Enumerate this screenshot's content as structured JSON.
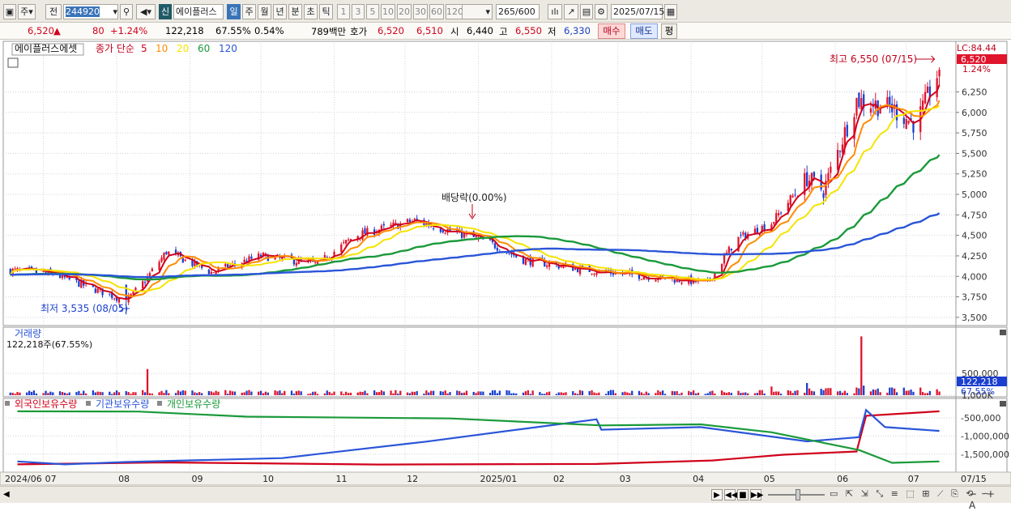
{
  "toolbar": {
    "type_label": "주",
    "prev_label": "전",
    "code": "244920",
    "name": "에이플러스",
    "sin": "신",
    "periods": [
      "일",
      "주",
      "월",
      "년",
      "분",
      "초",
      "틱"
    ],
    "active_period": "일",
    "nums": [
      "1",
      "3",
      "5",
      "10",
      "20",
      "30",
      "60",
      "120"
    ],
    "count": "265",
    "count_total": "/600",
    "date": "2025/07/15"
  },
  "info": {
    "price": "6,520",
    "change": "80",
    "change_pct": "+1.24%",
    "volume": "122,218",
    "vol_ratio": "67.55%",
    "turnover": "0.54%",
    "amount": "789백만",
    "hoga_label": "호가",
    "ask": "6,520",
    "bid": "6,510",
    "open_label": "시",
    "open": "6,440",
    "high_label": "고",
    "high": "6,550",
    "low_label": "저",
    "low": "6,330",
    "buy": "매수",
    "sell": "매도",
    "eval": "평"
  },
  "chart_data": [
    {
      "type": "candlestick",
      "title": "에이플러스에셋",
      "legend": {
        "label": "종가 단순",
        "periods": [
          "5",
          "10",
          "20",
          "60",
          "120"
        ],
        "colors": [
          "#d0021b",
          "#ff8c00",
          "#f5e400",
          "#1a9a3a",
          "#2a55d8"
        ]
      },
      "lc_label": "LC:84.44",
      "last_price_label": "6,520",
      "last_pct_label": "1.24%",
      "y_ticks": [
        "6,250",
        "6,000",
        "5,750",
        "5,500",
        "5,250",
        "5,000",
        "4,750",
        "4,500",
        "4,250",
        "4,000",
        "3,750",
        "3,500"
      ],
      "ylim": [
        3400,
        6650
      ],
      "annotations": {
        "high": "최고 6,550 (07/15)",
        "low": "최저 3,535 (08/05)",
        "dividend": "배당락(0.00%)"
      },
      "x_labels": [
        "2024/06",
        "07",
        "08",
        "09",
        "10",
        "11",
        "12",
        "2025/01",
        "02",
        "03",
        "04",
        "05",
        "06",
        "07"
      ],
      "x_label_right": "07/15",
      "close_keypoints": [
        {
          "date": "2024-06-20",
          "value": 4070
        },
        {
          "date": "2024-07-05",
          "value": 4030
        },
        {
          "date": "2024-08-05",
          "value": 3700
        },
        {
          "date": "2024-08-13",
          "value": 3950
        },
        {
          "date": "2024-08-22",
          "value": 4300
        },
        {
          "date": "2024-09-10",
          "value": 4050
        },
        {
          "date": "2024-10-01",
          "value": 4250
        },
        {
          "date": "2024-10-25",
          "value": 4150
        },
        {
          "date": "2024-11-10",
          "value": 4500
        },
        {
          "date": "2024-12-05",
          "value": 4680
        },
        {
          "date": "2025-01-05",
          "value": 4420
        },
        {
          "date": "2025-01-20",
          "value": 4200
        },
        {
          "date": "2025-02-15",
          "value": 4080
        },
        {
          "date": "2025-03-20",
          "value": 3980
        },
        {
          "date": "2025-04-08",
          "value": 3920
        },
        {
          "date": "2025-04-20",
          "value": 4450
        },
        {
          "date": "2025-05-05",
          "value": 4650
        },
        {
          "date": "2025-05-20",
          "value": 5200
        },
        {
          "date": "2025-05-27",
          "value": 5050
        },
        {
          "date": "2025-06-10",
          "value": 6150
        },
        {
          "date": "2025-06-25",
          "value": 6050
        },
        {
          "date": "2025-07-05",
          "value": 5850
        },
        {
          "date": "2025-07-15",
          "value": 6520
        }
      ]
    },
    {
      "type": "bar",
      "title": "거래량",
      "subtitle": "122,218주(67.55%)",
      "y_ticks": [
        "1,000K",
        "500,000"
      ],
      "last_label": "122,218",
      "last_pct": "67.55%",
      "spikes": [
        {
          "date": "2024-08-14",
          "value": 600000
        },
        {
          "date": "2025-05-05",
          "value": 200000
        },
        {
          "date": "2025-05-20",
          "value": 280000
        },
        {
          "date": "2025-06-12",
          "value": 1350000
        },
        {
          "date": "2025-06-13",
          "value": 220000
        }
      ],
      "typical_value": 70000
    },
    {
      "type": "line",
      "legend": [
        "외국인보유수량",
        "기관보유수량",
        "개인보유수량"
      ],
      "colors": [
        "#d0021b",
        "#2a55d8",
        "#1a9a3a"
      ],
      "y_ticks": [
        "-500,000",
        "-1,000,000",
        "-1,500,000"
      ],
      "series": [
        {
          "name": "외국인보유수량",
          "points": [
            [
              "2024-06-20",
              -1780000
            ],
            [
              "2024-08-20",
              -1730000
            ],
            [
              "2024-11-20",
              -1790000
            ],
            [
              "2025-02-20",
              -1760000
            ],
            [
              "2025-04-10",
              -1680000
            ],
            [
              "2025-05-10",
              -1510000
            ],
            [
              "2025-06-10",
              -1420000
            ],
            [
              "2025-06-14",
              -450000
            ],
            [
              "2025-07-15",
              -320000
            ]
          ]
        },
        {
          "name": "기관보유수량",
          "points": [
            [
              "2024-06-20",
              -1700000
            ],
            [
              "2024-07-10",
              -1780000
            ],
            [
              "2024-08-05",
              -1710000
            ],
            [
              "2024-10-10",
              -1600000
            ],
            [
              "2024-12-10",
              -1150000
            ],
            [
              "2025-01-20",
              -800000
            ],
            [
              "2025-02-20",
              -540000
            ],
            [
              "2025-02-22",
              -830000
            ],
            [
              "2025-04-05",
              -760000
            ],
            [
              "2025-05-20",
              -1150000
            ],
            [
              "2025-06-11",
              -1030000
            ],
            [
              "2025-06-14",
              -280000
            ],
            [
              "2025-06-22",
              -750000
            ],
            [
              "2025-07-15",
              -860000
            ]
          ]
        },
        {
          "name": "개인보유수량",
          "points": [
            [
              "2024-06-20",
              -320000
            ],
            [
              "2024-08-10",
              -330000
            ],
            [
              "2024-09-25",
              -460000
            ],
            [
              "2024-12-20",
              -510000
            ],
            [
              "2025-02-22",
              -700000
            ],
            [
              "2025-04-05",
              -680000
            ],
            [
              "2025-05-05",
              -900000
            ],
            [
              "2025-06-11",
              -1380000
            ],
            [
              "2025-06-25",
              -1740000
            ],
            [
              "2025-07-15",
              -1700000
            ]
          ]
        }
      ]
    }
  ]
}
